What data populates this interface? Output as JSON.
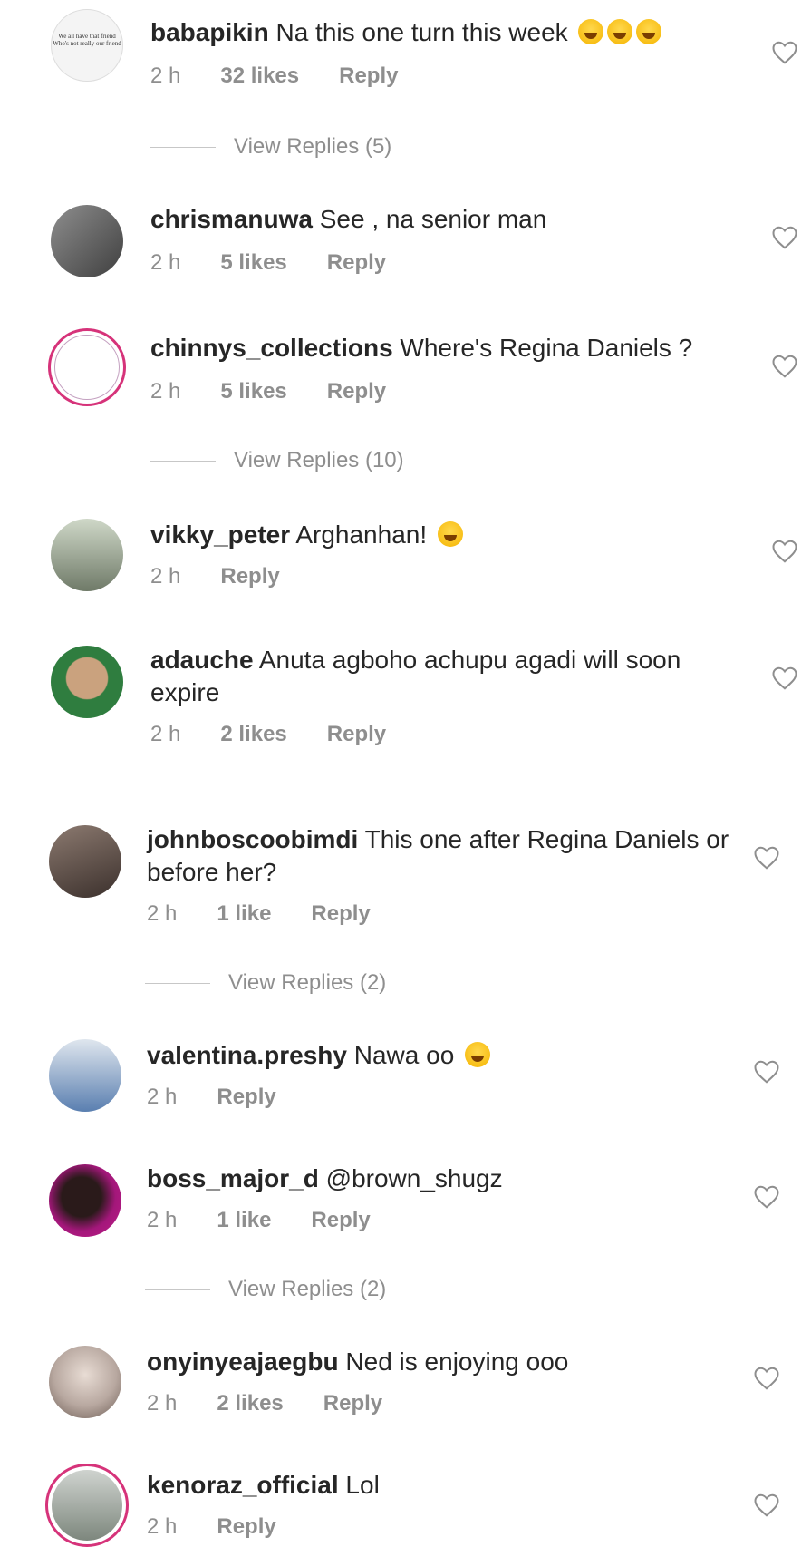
{
  "comments": [
    {
      "username": "babapikin",
      "text": "Na this one turn this week",
      "time": "2 h",
      "likes": "32 likes",
      "reply": "Reply",
      "view_replies": "View Replies (5)",
      "avatar_color": "#f4f4f4",
      "avatar_text": "We all have that friend Who's not really our friend"
    },
    {
      "username": "chrismanuwa",
      "text": "See , na senior man",
      "time": "2 h",
      "likes": "5 likes",
      "reply": "Reply",
      "avatar_color": "#6c6c6c"
    },
    {
      "username": "chinnys_collections",
      "text": "Where's Regina Daniels ?",
      "time": "2 h",
      "likes": "5 likes",
      "reply": "Reply",
      "view_replies": "View Replies (10)",
      "avatar_color": "#ffffff"
    },
    {
      "username": "vikky_peter",
      "text": "Arghanhan!",
      "time": "2 h",
      "reply": "Reply",
      "avatar_color": "#7d8a72"
    },
    {
      "username": "adauche",
      "text": "Anuta agboho achupu agadi will soon expire",
      "time": "2 h",
      "likes": "2 likes",
      "reply": "Reply",
      "avatar_color": "#3e8f4f"
    },
    {
      "username": "johnboscoobimdi",
      "text": "This one after Regina Daniels or before her?",
      "time": "2 h",
      "likes": "1 like",
      "reply": "Reply",
      "view_replies": "View Replies (2)",
      "avatar_color": "#5a4a44"
    },
    {
      "username": "valentina.preshy",
      "text": "Nawa oo",
      "time": "2 h",
      "reply": "Reply",
      "avatar_color": "#7aa9d6"
    },
    {
      "username": "boss_major_d",
      "text": "@brown_shugz",
      "time": "2 h",
      "likes": "1 like",
      "reply": "Reply",
      "view_replies": "View Replies (2)",
      "avatar_color": "#b0177a"
    },
    {
      "username": "onyinyeajaegbu",
      "text": "Ned is enjoying ooo",
      "time": "2 h",
      "likes": "2 likes",
      "reply": "Reply",
      "avatar_color": "#b8a8a0"
    },
    {
      "username": "kenoraz_official",
      "text": "Lol",
      "time": "2 h",
      "reply": "Reply",
      "avatar_color": "#9aa59a"
    }
  ]
}
